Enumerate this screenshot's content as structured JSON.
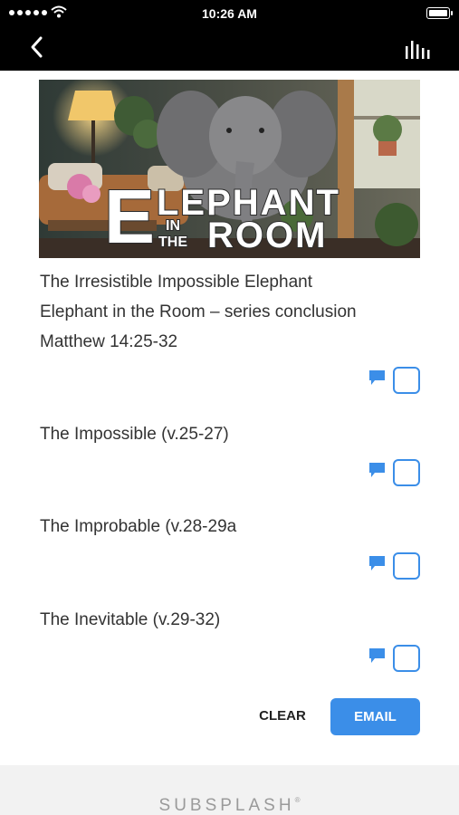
{
  "status_bar": {
    "time": "10:26 AM"
  },
  "hero": {
    "title_word1": "LEPHANT",
    "big_letter": "E",
    "small_in": "IN",
    "small_the": "THE",
    "title_word2": "ROOM"
  },
  "notes": {
    "header_lines": [
      "The Irresistible Impossible Elephant",
      "Elephant in the Room – series conclusion",
      "Matthew 14:25-32"
    ],
    "points": [
      "The Impossible (v.25-27)",
      "The Improbable (v.28-29a",
      "The Inevitable (v.29-32)"
    ]
  },
  "actions": {
    "clear_label": "CLEAR",
    "email_label": "EMAIL"
  },
  "footer": {
    "brand": "SUBSPLASH",
    "mark": "®"
  },
  "colors": {
    "accent": "#3b8ee8",
    "bar": "#000000"
  }
}
